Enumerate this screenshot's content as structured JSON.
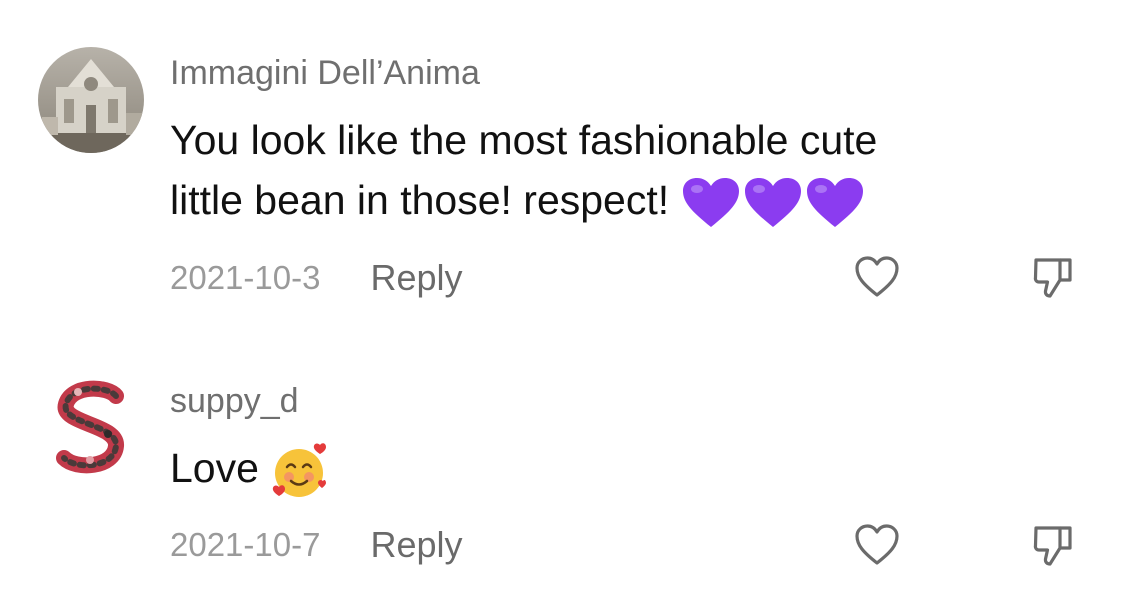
{
  "comments": [
    {
      "username": "Immagini Dell’Anima",
      "text_line1": "You look like the most fashionable cute",
      "text_line2": "little bean in those! respect!",
      "emoji": [
        "purple-heart",
        "purple-heart",
        "purple-heart"
      ],
      "date": "2021-10-3",
      "reply_label": "Reply"
    },
    {
      "username": "suppy_d",
      "text": "Love",
      "emoji": [
        "smiling-face-with-hearts"
      ],
      "date": "2021-10-7",
      "reply_label": "Reply"
    }
  ],
  "colors": {
    "username": "#6f6f6f",
    "text": "#111111",
    "date": "#9a9a9a",
    "reply": "#6a6a6a",
    "icon_stroke": "#6b6b6b",
    "purple_heart": "#8b3cf0"
  }
}
